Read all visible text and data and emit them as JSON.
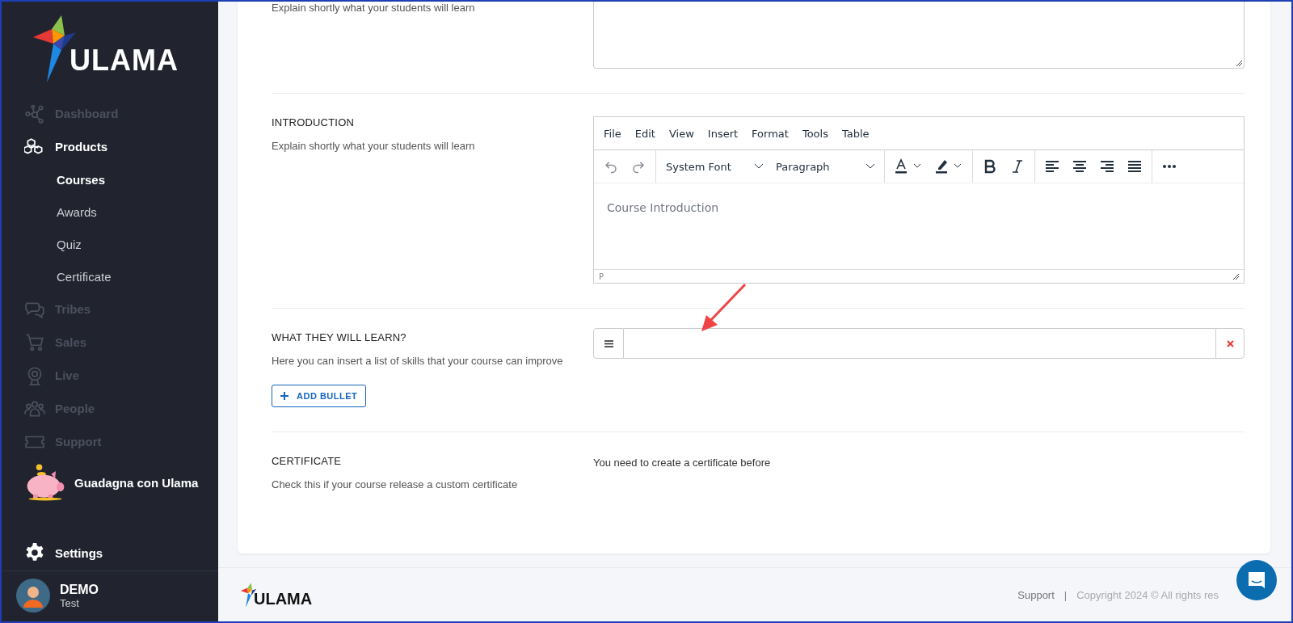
{
  "sidebar": {
    "logo": "ULAMA",
    "items": [
      {
        "label": "Dashboard",
        "disabled": true
      },
      {
        "label": "Products",
        "disabled": false,
        "children": [
          {
            "label": "Courses",
            "selected": true
          },
          {
            "label": "Awards",
            "selected": false
          },
          {
            "label": "Quiz",
            "selected": false
          },
          {
            "label": "Certificate",
            "selected": false
          }
        ]
      },
      {
        "label": "Tribes",
        "disabled": true
      },
      {
        "label": "Sales",
        "disabled": true
      },
      {
        "label": "Live",
        "disabled": true
      },
      {
        "label": "People",
        "disabled": true
      },
      {
        "label": "Support",
        "disabled": true
      }
    ],
    "promo": "Guadagna con Ulama",
    "settings": "Settings",
    "user": {
      "name": "DEMO",
      "role": "Test"
    }
  },
  "form": {
    "sections": [
      {
        "kind": "textarea",
        "hint": "Explain shortly what your students will learn"
      },
      {
        "kind": "editor",
        "title": "INTRODUCTION",
        "hint": "Explain shortly what your students will learn",
        "menu": [
          "File",
          "Edit",
          "View",
          "Insert",
          "Format",
          "Tools",
          "Table"
        ],
        "font": "System Font",
        "block": "Paragraph",
        "placeholder": "Course Introduction",
        "status": "P"
      },
      {
        "kind": "bullets",
        "title": "WHAT THEY WILL LEARN?",
        "hint": "Here you can insert a list of skills that your course can improve",
        "add": "ADD BULLET"
      },
      {
        "kind": "info",
        "title": "CERTIFICATE",
        "hint": "Check this if your course release a custom certificate",
        "note": "You need to create a certificate before"
      }
    ]
  },
  "footer": {
    "logo": "ULAMA",
    "link": "Support",
    "separator": "|",
    "copyright": "Copyright 2024 © All rights res"
  }
}
